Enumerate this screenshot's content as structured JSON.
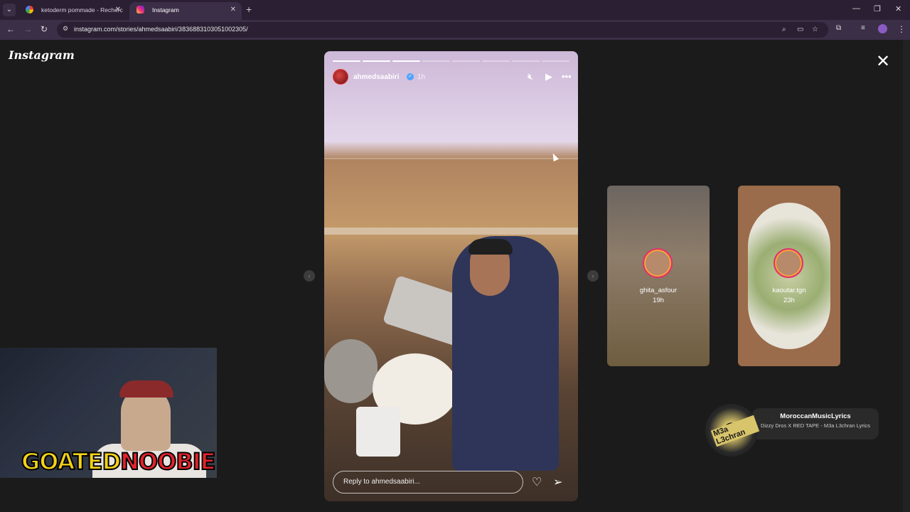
{
  "browser": {
    "tabs": [
      {
        "title": "ketoderm pommade - Recherc",
        "active": false,
        "favicon": "google-icon"
      },
      {
        "title": "Instagram",
        "active": true,
        "favicon": "instagram-icon"
      }
    ],
    "url": "instagram.com/stories/ahmedsaabiri/3836883103051002305/"
  },
  "instagram": {
    "logo": "Instagram",
    "story": {
      "username": "ahmedsaabiri",
      "time": "1h",
      "verified": true,
      "progress_segments": 8,
      "progress_completed": 3,
      "reply_placeholder": "Reply to ahmedsaabiri..."
    },
    "previews": [
      {
        "username": "ghita_asfour",
        "time": "19h"
      },
      {
        "username": "kaoutar.tgn",
        "time": "23h"
      }
    ]
  },
  "overlay": {
    "webcam_tag_part1": "GOATED",
    "webcam_tag_part2": "NOOBIE",
    "music_disc_text": "M3a L3chran",
    "music_channel": "MoroccanMusicLyrics",
    "music_title": "Dizzy Dros X RED TAPE - M3a L3chran Lyrics"
  },
  "colors": {
    "accent_ring": "#e1306c",
    "verified": "#4fa3ff",
    "tag_yellow": "#f3d117",
    "tag_red": "#e3232b"
  }
}
